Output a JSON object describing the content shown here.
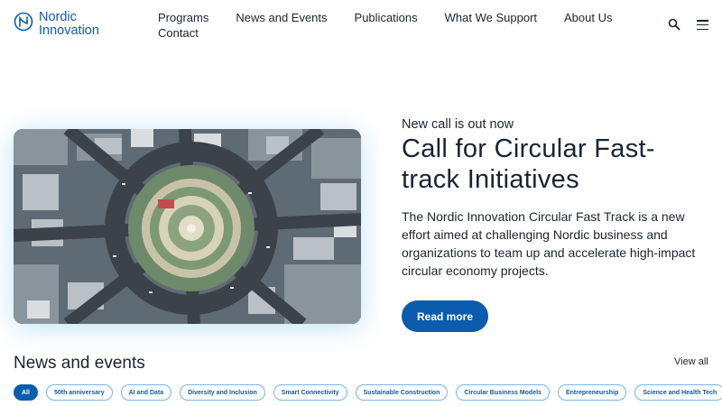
{
  "header": {
    "logo_line1": "Nordic",
    "logo_line2": "Innovation",
    "nav": [
      "Programs",
      "News and Events",
      "Publications",
      "What We Support",
      "About Us",
      "Contact"
    ]
  },
  "hero": {
    "eyebrow": "New call is out now",
    "title": "Call for Circular Fast-track Initiatives",
    "description": "The Nordic Innovation Circular Fast Track is a new effort aimed at challenging Nordic business and organizations to team up and accelerate high-impact circular economy projects.",
    "button": "Read more"
  },
  "news": {
    "title": "News and events",
    "view_all": "View all",
    "filters": [
      "All",
      "50th anniversary",
      "AI and Data",
      "Diversity and Inclusion",
      "Smart Connectivity",
      "Sustainable Construction",
      "Circular Business Models",
      "Entrepreneurship",
      "Science and Health Tech"
    ]
  },
  "colors": {
    "brand_blue": "#0b5cad",
    "text": "#1b2331",
    "chip_border": "#78b4e6"
  }
}
